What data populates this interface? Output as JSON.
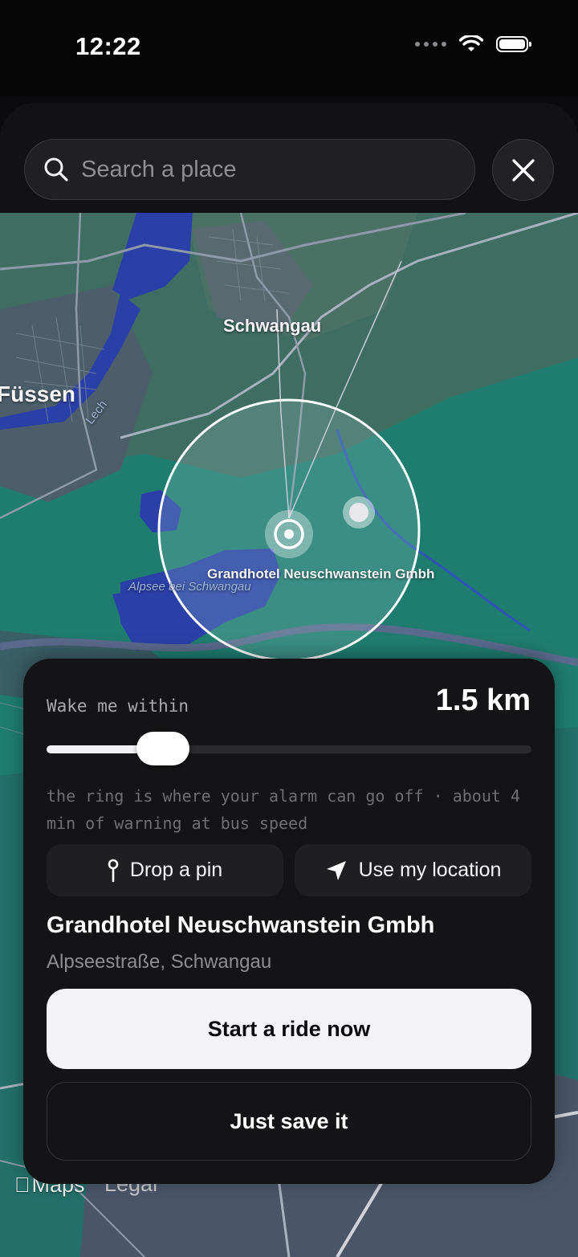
{
  "status_bar": {
    "time": "12:22"
  },
  "search": {
    "placeholder": "Search a place"
  },
  "map": {
    "labels": {
      "schwangau": "Schwangau",
      "fussen": "Füssen",
      "lech": "Lech",
      "alpsee": "Alpsee bei Schwangau",
      "hotel": "Grandhotel Neuschwanstein Gmbh"
    },
    "attribution": {
      "logo": "Maps",
      "legal": "Legal"
    }
  },
  "sheet": {
    "wake_label": "Wake me within",
    "distance": "1.5 km",
    "slider_fraction": 0.24,
    "hint": "the ring is where your alarm can go off · about 4 min of warning at bus speed",
    "drop_pin_label": "Drop a pin",
    "use_location_label": "Use my location",
    "place_name": "Grandhotel Neuschwanstein Gmbh",
    "place_address": "Alpseestraße, Schwangau",
    "start_ride_label": "Start a ride now",
    "save_label": "Just save it"
  },
  "colors": {
    "map_forest": "#1f7d70",
    "map_water": "#2b3fa8",
    "sheet_bg": "#141416",
    "primary_button": "#f2f2f7"
  }
}
